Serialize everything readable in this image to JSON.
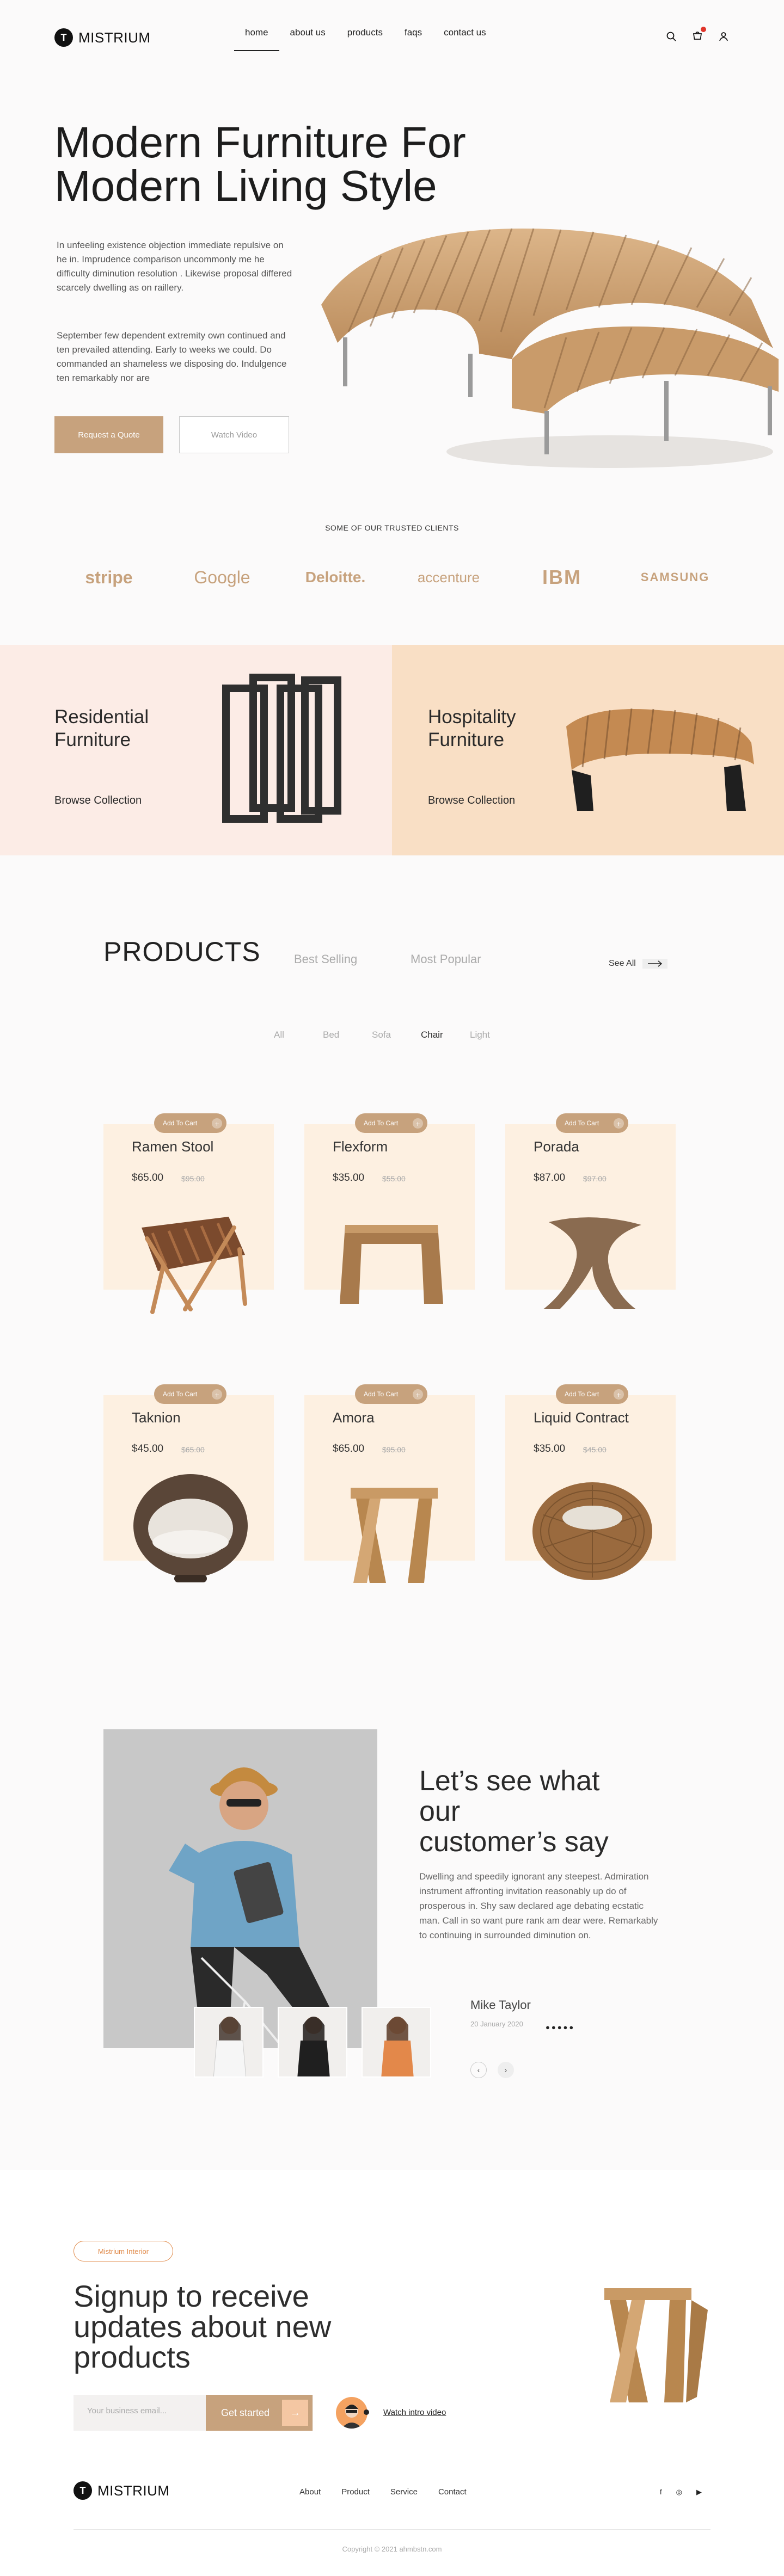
{
  "brand": {
    "name": "MISTRIUM",
    "mark": "T"
  },
  "nav": {
    "links": [
      "home",
      "about us",
      "products",
      "faqs",
      "contact us"
    ],
    "active": "home"
  },
  "hero": {
    "title_line1": "Modern Furniture For",
    "title_line2": "Modern Living Style",
    "paragraph1": " In unfeeling existence objection immediate repulsive on he in. Imprudence comparison uncommonly me he difficulty diminution resolution . Likewise proposal differed scarcely dwelling as on raillery.",
    "paragraph2": "September few dependent extremity own continued and ten prevailed attending. Early to weeks we could. Do commanded an shameless we disposing do. Indulgence ten remarkably nor are",
    "btn_quote": "Request a Quote",
    "btn_video": "Watch Video"
  },
  "clients": {
    "heading": "SOME OF OUR TRUSTED CLIENTS",
    "logos": [
      "stripe",
      "Google",
      "Deloitte.",
      "accenture",
      "IBM",
      "SAMSUNG"
    ]
  },
  "categories": [
    {
      "title_line1": "Residential",
      "title_line2": "Furniture",
      "link": "Browse Collection"
    },
    {
      "title_line1": "Hospitality",
      "title_line2": "Furniture",
      "link": "Browse Collection"
    }
  ],
  "products": {
    "title": "PRODUCTS",
    "tabs": [
      "Best Selling",
      "Most Popular"
    ],
    "see_all": "See All",
    "filters": [
      "All",
      "Bed",
      "Sofa",
      "Chair",
      "Light"
    ],
    "active_filter": "Chair",
    "add_to_cart": "Add To Cart",
    "items": [
      {
        "name": "Ramen Stool",
        "price": "$65.00",
        "old": "$95.00"
      },
      {
        "name": "Flexform",
        "price": "$35.00",
        "old": "$55.00"
      },
      {
        "name": "Porada",
        "price": "$87.00",
        "old": "$97.00"
      },
      {
        "name": "Taknion",
        "price": "$45.00",
        "old": "$65.00"
      },
      {
        "name": "Amora",
        "price": "$65.00",
        "old": "$95.00"
      },
      {
        "name": "Liquid Contract",
        "price": "$35.00",
        "old": "$45.00"
      }
    ]
  },
  "testimonial": {
    "title_line1": "Let’s see what",
    "title_line2": "our",
    "title_line3": "customer’s say",
    "text": "Dwelling and speedily ignorant any steepest. Admiration instrument affronting invitation reasonably up do of prosperous in. Shy saw declared age debating ecstatic man. Call in so want pure rank am dear were. Remarkably to continuing in surrounded diminution on.",
    "name": "Mike Taylor",
    "date": "20 January 2020",
    "stars": "●●●●●",
    "prev": "‹",
    "next": "›"
  },
  "signup": {
    "pill": "Mistrium Interior",
    "title_line1": "Signup to receive",
    "title_line2": "updates about new",
    "title_line3": "products",
    "placeholder": "Your business email...",
    "button": "Get started",
    "button_arrow": "→",
    "intro": "Watch intro video"
  },
  "footer": {
    "links": [
      "About",
      "Product",
      "Service",
      "Contact"
    ],
    "socials": [
      "f",
      "◎",
      "▶"
    ],
    "copyright": "Copyright © 2021 ahmbstn.com"
  },
  "colors": {
    "accent": "#c7a27d",
    "panel_left": "#fcece6",
    "panel_right": "#f9dfc5",
    "card": "#fdf0e1",
    "alert": "#e0352b"
  }
}
